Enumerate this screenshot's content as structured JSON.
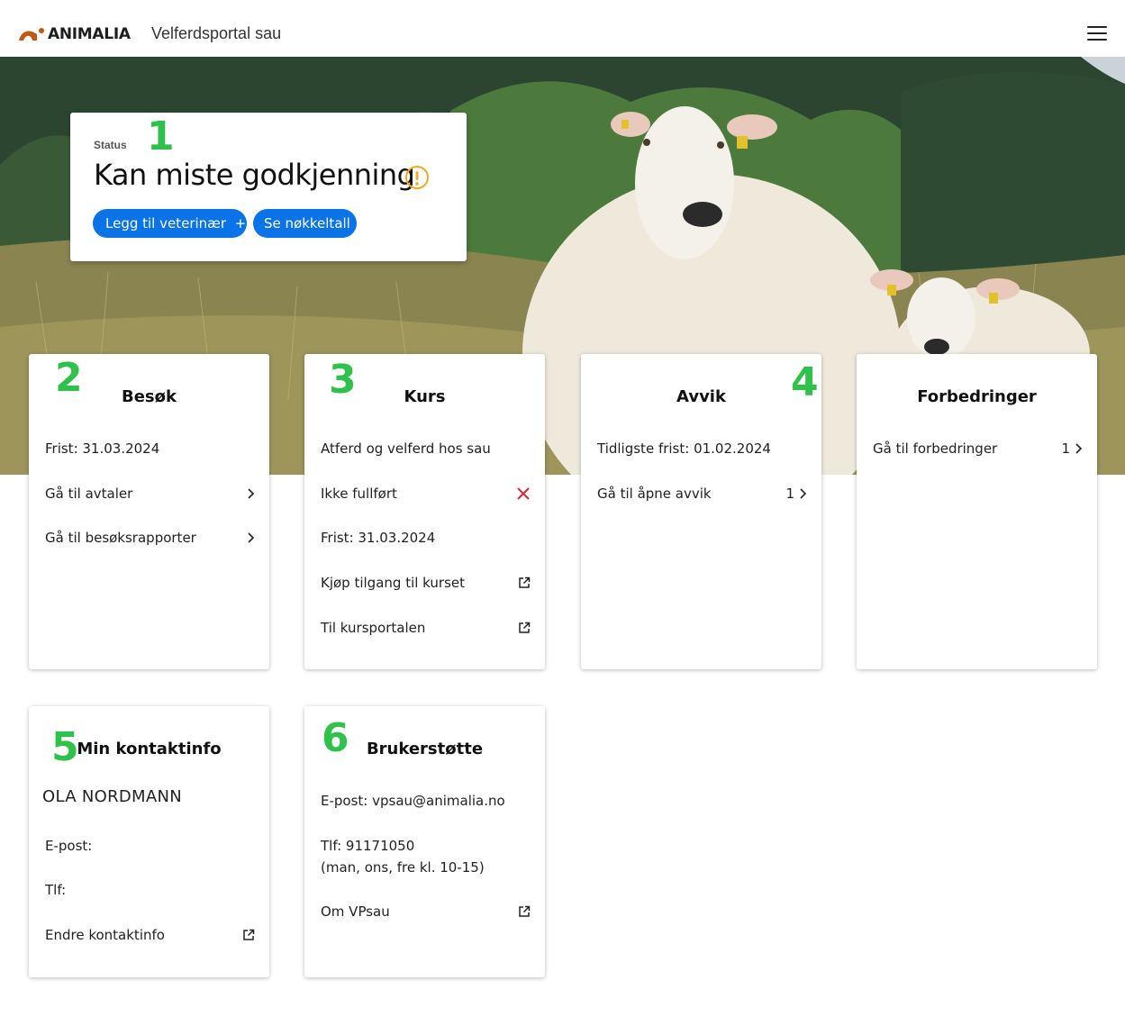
{
  "header": {
    "logo_text": "ANIMALIA",
    "portal_title": "Velferdsportal sau",
    "menu_icon": "hamburger-icon",
    "logo_color": "#c05a12"
  },
  "status": {
    "label": "Status",
    "text": "Kan miste godkjenning",
    "icon": "warning-icon",
    "icon_color": "#f0a920",
    "btn_add_vet": "Legg til veterinær",
    "btn_add_vet_icon": "+",
    "btn_key_figures": "Se nøkkeltall",
    "button_color": "#0a73e8"
  },
  "badges": [
    "1",
    "2",
    "3",
    "4",
    "5",
    "6"
  ],
  "badge_color": "#2fc24a",
  "cards": {
    "besok": {
      "title": "Besøk",
      "deadline": "Frist:  31.03.2024",
      "link_avtaler": "Gå til avtaler",
      "link_rapporter": "Gå til besøksrapporter"
    },
    "kurs": {
      "title": "Kurs",
      "course_name": "Atferd og velferd hos sau",
      "status": "Ikke fullført",
      "deadline": "Frist: 31.03.2024",
      "buy_access": "Kjøp tilgang til kurset",
      "portal": "Til kursportalen",
      "status_color": "#e0262f"
    },
    "avvik": {
      "title": "Avvik",
      "earliest_deadline": "Tidligste frist: 01.02.2024",
      "link_open": "Gå til åpne avvik",
      "count": "1"
    },
    "forbedringer": {
      "title": "Forbedringer",
      "link": "Gå til forbedringer",
      "count": "1"
    },
    "kontakt": {
      "title": "Min kontaktinfo",
      "name": "OLA NORDMANN",
      "email_label": "E-post:",
      "phone_label": "Tlf:",
      "edit_link": "Endre kontaktinfo"
    },
    "support": {
      "title": "Brukerstøtte",
      "email": "E-post: vpsau@animalia.no",
      "phone": "Tlf: 91171050",
      "hours": "(man, ons, fre kl. 10-15)",
      "about_link": "Om VPsau"
    }
  }
}
